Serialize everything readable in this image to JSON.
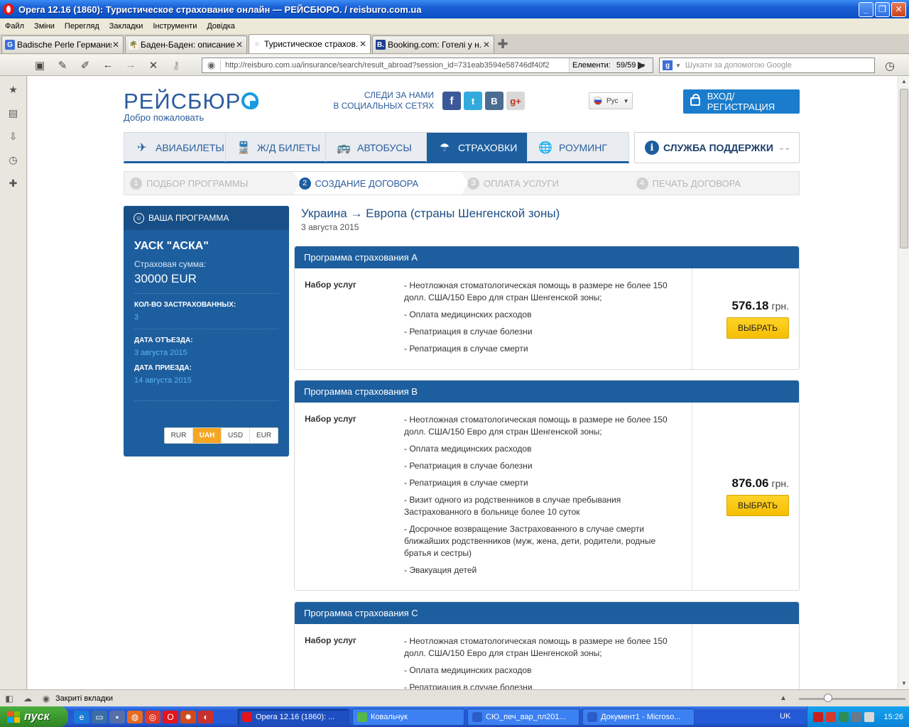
{
  "window": {
    "title": "Opera 12.16 (1860): Туристическое страхование онлайн — РЕЙСБЮРО. / reisburo.com.ua",
    "min": "_",
    "max": "❐",
    "close": "✕"
  },
  "menu": [
    "Файл",
    "Зміни",
    "Перегляд",
    "Закладки",
    "Інструменти",
    "Довідка"
  ],
  "tabs": [
    {
      "label": "Badische Perle Германия...",
      "icon": "G",
      "color": "#3b6fd6"
    },
    {
      "label": "Баден-Баден: описание...",
      "icon": "🌴",
      "color": "#2e8b2e"
    },
    {
      "label": "Туристическое страхов...",
      "icon": "○",
      "color": "#888888",
      "active": true
    },
    {
      "label": "Booking.com: Готелі у н...",
      "icon": "B.",
      "color": "#1c3f8f"
    }
  ],
  "nav": {
    "url": "http://reisburo.com.ua/insurance/search/result_abroad?session_id=731eab3594e58746df40f2",
    "elements_label": "Елементи:",
    "elements_count": "59/59",
    "search_placeholder": "Шукати за допомогою Google"
  },
  "site": {
    "logo": "РЕЙСБЮР",
    "welcome": "Добро пожаловать",
    "social_line1": "СЛЕДИ ЗА НАМИ",
    "social_line2": "В СОЦИАЛЬНЫХ СЕТЯХ",
    "lang": "Рус",
    "login": "ВХОД/РЕГИСТРАЦИЯ",
    "menu": [
      {
        "label": "АВИАБИЛЕТЫ",
        "icon": "✈"
      },
      {
        "label": "Ж/Д БИЛЕТЫ",
        "icon": "🚆"
      },
      {
        "label": "АВТОБУСЫ",
        "icon": "🚌"
      },
      {
        "label": "СТРАХОВКИ",
        "icon": "☂",
        "active": true
      },
      {
        "label": "РОУМИНГ",
        "icon": "🌐"
      }
    ],
    "support": "СЛУЖБА ПОДДЕРЖКИ",
    "steps": [
      {
        "num": "1",
        "label": "ПОДБОР ПРОГРАММЫ"
      },
      {
        "num": "2",
        "label": "СОЗДАНИЕ ДОГОВОРА",
        "active": true
      },
      {
        "num": "3",
        "label": "ОПЛАТА УСЛУГИ"
      },
      {
        "num": "4",
        "label": "ПЕЧАТЬ ДОГОВОРА"
      }
    ]
  },
  "sidebar": {
    "header": "ВАША ПРОГРАММА",
    "company": "УАСК \"АСКА\"",
    "sum_label": "Страховая сумма:",
    "sum": "30000 EUR",
    "insured_label": "КОЛ-ВО ЗАСТРАХОВАННЫХ:",
    "insured": "3",
    "depart_label": "ДАТА ОТЪЕЗДА:",
    "depart": "3 августа 2015",
    "arrive_label": "ДАТА ПРИЕЗДА:",
    "arrive": "14 августа 2015",
    "currencies": [
      "RUR",
      "UAH",
      "USD",
      "EUR"
    ],
    "currency_selected": "UAH"
  },
  "route": "Украина → Европа (страны Шенгенской зоны)",
  "route_date": "3 августа 2015",
  "services_label": "Набор услуг",
  "choose_label": "ВЫБРАТЬ",
  "programs": [
    {
      "title": "Программа страхования А",
      "price": "576.18",
      "currency": "грн.",
      "services": [
        " - Неотложная стоматологическая помощь в размере не более 150 долл. США/150 Евро для стран Шенгенской зоны;",
        "- Оплата медицинских расходов",
        "- Репатриация в случае болезни",
        "- Репатриация в случае смерти"
      ]
    },
    {
      "title": "Программа страхования В",
      "price": "876.06",
      "currency": "грн.",
      "services": [
        " - Неотложная стоматологическая помощь в размере не более 150 долл. США/150 Евро для стран Шенгенской зоны;",
        "- Оплата медицинских расходов",
        "- Репатриация в случае болезни",
        "- Репатриация в случае смерти",
        "- Визит одного из родственников в случае пребывания Застрахованного в больнице более 10 суток",
        "- Досрочное возвращение Застрахованного в случае смерти ближайших родственников (муж, жена, дети, родители, родные братья и сестры)",
        "- Эвакуация детей"
      ]
    },
    {
      "title": "Программа страхования С",
      "price": "",
      "currency": "",
      "services": [
        " - Неотложная стоматологическая помощь в размере не более 150 долл. США/150 Евро для стран Шенгенской зоны;",
        "- Оплата медицинских расходов",
        "- Репатриация в случае болезни"
      ]
    }
  ],
  "statusbar": {
    "closed_tabs": "Закриті вкладки"
  },
  "taskbar": {
    "start": "пуск",
    "tasks": [
      {
        "label": "Opera 12.16 (1860): ...",
        "color": "#e3141b",
        "active": true
      },
      {
        "label": "Ковальчук",
        "color": "#55b848"
      },
      {
        "label": "СЮ_печ_вар_пл201...",
        "color": "#2b5cc8"
      },
      {
        "label": "Документ1 - Microso...",
        "color": "#2b5cc8"
      }
    ],
    "lang": "UK",
    "clock": "15:26"
  }
}
